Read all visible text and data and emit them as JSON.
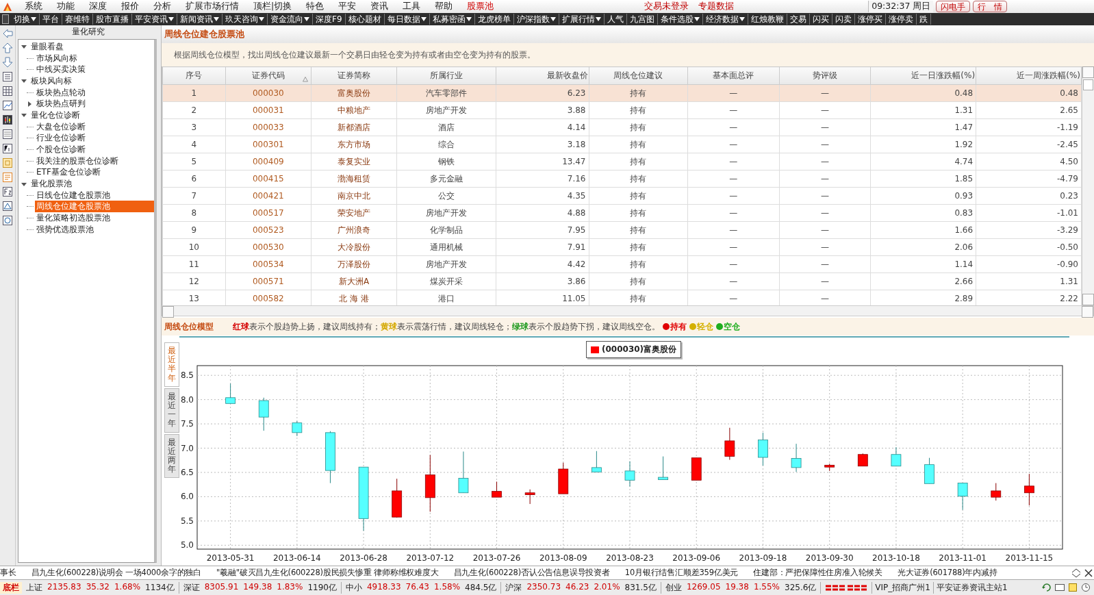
{
  "menu_bar": {
    "items": [
      {
        "label": "系统",
        "kind": "menu"
      },
      {
        "label": "功能",
        "kind": "menu"
      },
      {
        "label": "深度",
        "kind": "menu"
      },
      {
        "label": "报价",
        "kind": "menu"
      },
      {
        "label": "分析",
        "kind": "menu"
      },
      {
        "label": "扩展市场行情",
        "kind": "menu"
      },
      {
        "label": "顶栏|切换",
        "kind": "menu"
      },
      {
        "label": "特色",
        "kind": "menu"
      },
      {
        "label": "平安",
        "kind": "menu"
      },
      {
        "label": "资讯",
        "kind": "menu"
      },
      {
        "label": "工具",
        "kind": "menu"
      },
      {
        "label": "帮助",
        "kind": "menu"
      },
      {
        "label": "股票池",
        "kind": "highlight"
      }
    ],
    "notices": [
      "交易未登录",
      "专题数据"
    ],
    "clock": "09:32:37 周日",
    "buttons": [
      "闪电手",
      "行　情"
    ]
  },
  "toolbar": {
    "items": [
      {
        "label": "切换",
        "dropdown": true
      },
      {
        "label": "平台",
        "dropdown": false
      },
      {
        "label": "赛维特",
        "dropdown": false
      },
      {
        "label": "股市直播",
        "dropdown": false
      },
      {
        "label": "平安资讯",
        "dropdown": true
      },
      {
        "label": "新闻资讯",
        "dropdown": true
      },
      {
        "label": "玖天咨询",
        "dropdown": true
      },
      {
        "label": "资金流向",
        "dropdown": true
      },
      {
        "label": "深度F9",
        "dropdown": false
      },
      {
        "label": "核心题材",
        "dropdown": false
      },
      {
        "label": "每日数据",
        "dropdown": true
      },
      {
        "label": "私募密函",
        "dropdown": true
      },
      {
        "label": "龙虎榜单",
        "dropdown": false
      },
      {
        "label": "沪深指数",
        "dropdown": true
      },
      {
        "label": "扩展行情",
        "dropdown": true
      },
      {
        "label": "人气",
        "dropdown": false
      },
      {
        "label": "九宫图",
        "dropdown": false
      },
      {
        "label": "条件选股",
        "dropdown": true
      },
      {
        "label": "经济数据",
        "dropdown": true
      },
      {
        "label": "红烛教鞭",
        "dropdown": false
      },
      {
        "label": "交易",
        "dropdown": false
      },
      {
        "label": "闪买",
        "dropdown": false
      },
      {
        "label": "闪卖",
        "dropdown": false
      },
      {
        "label": "涨停买",
        "dropdown": false
      },
      {
        "label": "涨停卖",
        "dropdown": false
      },
      {
        "label": "跌",
        "dropdown": false
      }
    ]
  },
  "tree": {
    "title": "量化研究",
    "items": [
      {
        "label": "量眼看盘",
        "expanded": true,
        "selected": false,
        "children": [
          {
            "label": "市场风向标",
            "selected": false
          },
          {
            "label": "中线买卖决策",
            "selected": false
          }
        ]
      },
      {
        "label": "板块风向标",
        "expanded": true,
        "selected": false,
        "children": [
          {
            "label": "板块热点轮动",
            "selected": false
          },
          {
            "label": "板块热点研判",
            "expanded": false,
            "selected": false
          }
        ]
      },
      {
        "label": "量化仓位诊断",
        "expanded": true,
        "selected": false,
        "children": [
          {
            "label": "大盘仓位诊断",
            "selected": false
          },
          {
            "label": "行业仓位诊断",
            "selected": false
          },
          {
            "label": "个股仓位诊断",
            "selected": false
          },
          {
            "label": "我关注的股票仓位诊断",
            "selected": false
          },
          {
            "label": "ETF基金仓位诊断",
            "selected": false
          }
        ]
      },
      {
        "label": "量化股票池",
        "expanded": true,
        "selected": false,
        "children": [
          {
            "label": "日线仓位建仓股票池",
            "selected": false
          },
          {
            "label": "周线仓位建仓股票池",
            "selected": true
          },
          {
            "label": "量化策略初选股票池",
            "selected": false
          },
          {
            "label": "强势优选股票池",
            "selected": false
          }
        ]
      }
    ]
  },
  "pool": {
    "title": "周线仓位建仓股票池",
    "description": "根据周线仓位模型，找出周线仓位建议最新一个交易日由轻仓变为持有或者由空仓变为持有的股票。",
    "table": {
      "columns": [
        {
          "label": "序号",
          "sorted": false
        },
        {
          "label": "证券代码",
          "sorted": true
        },
        {
          "label": "证券简称",
          "sorted": false
        },
        {
          "label": "所属行业",
          "sorted": false
        },
        {
          "label": "最新收盘价",
          "sorted": false
        },
        {
          "label": "周线仓位建议",
          "sorted": false
        },
        {
          "label": "基本面总评",
          "sorted": false
        },
        {
          "label": "势评级",
          "sorted": false
        },
        {
          "label": "近一日涨跌幅(%)",
          "sorted": false
        },
        {
          "label": "近一周涨跌幅(%)",
          "sorted": false
        }
      ],
      "rows": [
        {
          "selected": true,
          "cells": [
            "1",
            "000030",
            "富奥股份",
            "汽车零部件",
            "6.23",
            "持有",
            "—",
            "—",
            "0.48",
            "0.48"
          ]
        },
        {
          "selected": false,
          "cells": [
            "2",
            "000031",
            "中粮地产",
            "房地产开发",
            "3.88",
            "持有",
            "—",
            "—",
            "1.31",
            "2.65"
          ]
        },
        {
          "selected": false,
          "cells": [
            "3",
            "000033",
            "新都酒店",
            "酒店",
            "4.14",
            "持有",
            "—",
            "—",
            "1.47",
            "-1.19"
          ]
        },
        {
          "selected": false,
          "cells": [
            "4",
            "000301",
            "东方市场",
            "综合",
            "3.18",
            "持有",
            "—",
            "—",
            "1.92",
            "-2.45"
          ]
        },
        {
          "selected": false,
          "cells": [
            "5",
            "000409",
            "泰复实业",
            "钢铁",
            "13.47",
            "持有",
            "—",
            "—",
            "4.74",
            "4.50"
          ]
        },
        {
          "selected": false,
          "cells": [
            "6",
            "000415",
            "渤海租赁",
            "多元金融",
            "7.16",
            "持有",
            "—",
            "—",
            "1.85",
            "-4.79"
          ]
        },
        {
          "selected": false,
          "cells": [
            "7",
            "000421",
            "南京中北",
            "公交",
            "4.35",
            "持有",
            "—",
            "—",
            "0.93",
            "0.23"
          ]
        },
        {
          "selected": false,
          "cells": [
            "8",
            "000517",
            "荣安地产",
            "房地产开发",
            "4.88",
            "持有",
            "—",
            "—",
            "0.83",
            "-1.01"
          ]
        },
        {
          "selected": false,
          "cells": [
            "9",
            "000523",
            "广州浪奇",
            "化学制品",
            "7.95",
            "持有",
            "—",
            "—",
            "1.66",
            "-3.29"
          ]
        },
        {
          "selected": false,
          "cells": [
            "10",
            "000530",
            "大冷股份",
            "通用机械",
            "7.91",
            "持有",
            "—",
            "—",
            "2.06",
            "-0.50"
          ]
        },
        {
          "selected": false,
          "cells": [
            "11",
            "000534",
            "万泽股份",
            "房地产开发",
            "4.42",
            "持有",
            "—",
            "—",
            "1.14",
            "-0.90"
          ]
        },
        {
          "selected": false,
          "cells": [
            "12",
            "000571",
            "新大洲A",
            "煤炭开采",
            "3.86",
            "持有",
            "—",
            "—",
            "2.66",
            "1.31"
          ]
        },
        {
          "selected": false,
          "cells": [
            "13",
            "000582",
            "北 海 港",
            "港口",
            "11.05",
            "持有",
            "—",
            "—",
            "2.89",
            "2.22"
          ]
        }
      ]
    }
  },
  "model_legend": {
    "title": "周线仓位模型",
    "notes": [
      {
        "ball": "红球",
        "color": "#d40000",
        "text": "表示个股趋势上扬，建议周线持有；"
      },
      {
        "ball": "黄球",
        "color": "#d4a800",
        "text": "表示震荡行情，建议周线轻仓；"
      },
      {
        "ball": "绿球",
        "color": "#1f9a1f",
        "text": "表示个股趋势下拐，建议周线空仓。"
      }
    ],
    "keys": [
      {
        "label": "持有",
        "color": "#e00000"
      },
      {
        "label": "轻仓",
        "color": "#d4b000"
      },
      {
        "label": "空仓",
        "color": "#1fae1f"
      }
    ]
  },
  "chart": {
    "tabs": [
      {
        "label": "最近半年",
        "selected": true
      },
      {
        "label": "最近一年",
        "selected": false
      },
      {
        "label": "最近两年",
        "selected": false
      }
    ],
    "chart_data": {
      "type": "candlestick",
      "categories": [
        "2013-05-31",
        null,
        "2013-06-14",
        null,
        "2013-06-28",
        null,
        "2013-07-12",
        null,
        "2013-07-26",
        null,
        "2013-08-09",
        null,
        "2013-08-23",
        null,
        "2013-09-06",
        null,
        "2013-09-18",
        null,
        "2013-09-30",
        null,
        "2013-10-18",
        null,
        "2013-11-01",
        null,
        "2013-11-15"
      ],
      "ylim": [
        4.92,
        8.7
      ],
      "grid": true,
      "yticks": [
        {
          "value": 5,
          "label": "5.0"
        },
        {
          "value": 5.5,
          "label": "5.5"
        },
        {
          "value": 6,
          "label": "6.0"
        },
        {
          "value": 6.5,
          "label": "6.5"
        },
        {
          "value": 7,
          "label": "7.0"
        },
        {
          "value": 7.5,
          "label": "7.5"
        },
        {
          "value": 8,
          "label": "8.0"
        },
        {
          "value": 8.5,
          "label": "8.5"
        }
      ],
      "series": [
        {
          "name": "(000030)富奥股份",
          "ohlc": [
            [
              8.04,
              8.33,
              7.92,
              7.92
            ],
            [
              7.98,
              8.04,
              7.36,
              7.64
            ],
            [
              7.52,
              7.56,
              7.25,
              7.32
            ],
            [
              7.32,
              7.35,
              6.28,
              6.54
            ],
            [
              6.61,
              6.61,
              5.3,
              5.55
            ],
            [
              5.58,
              6.37,
              5.57,
              6.12
            ],
            [
              5.98,
              6.86,
              5.69,
              6.45
            ],
            [
              6.38,
              6.93,
              6.08,
              6.08
            ],
            [
              5.99,
              6.31,
              5.99,
              6.11
            ],
            [
              6.04,
              6.15,
              5.85,
              6.08
            ],
            [
              6.06,
              6.7,
              6.06,
              6.57
            ],
            [
              6.6,
              6.94,
              6.51,
              6.51
            ],
            [
              6.53,
              6.73,
              6.21,
              6.34
            ],
            [
              6.4,
              6.83,
              6.35,
              6.35
            ],
            [
              6.34,
              6.8,
              6.34,
              6.8
            ],
            [
              6.83,
              7.42,
              6.76,
              7.15
            ],
            [
              7.17,
              7.32,
              6.64,
              6.81
            ],
            [
              6.79,
              7.09,
              6.51,
              6.6
            ],
            [
              6.61,
              6.68,
              6.53,
              6.65
            ],
            [
              6.63,
              6.89,
              6.63,
              6.87
            ],
            [
              6.87,
              7.02,
              6.63,
              6.63
            ],
            [
              6.66,
              6.8,
              6.27,
              6.27
            ],
            [
              6.28,
              6.28,
              5.73,
              6.01
            ],
            [
              5.99,
              6.28,
              5.92,
              6.12
            ],
            [
              6.08,
              6.47,
              5.82,
              6.22
            ]
          ]
        }
      ]
    }
  },
  "news_ticker": {
    "items": [
      "事长",
      "昌九生化(600228)说明会 一场4000余字的独白",
      "\"羲融\"破灭昌九生化(600228)股民损失惨重 律师称维权难度大",
      "昌九生化(600228)否认公告信息误导投资者",
      "10月银行结售汇顺差359亿美元",
      "住建部：严把保障性住房准入轮候关",
      "光大证券(601788)年内减持"
    ]
  },
  "status_bar": {
    "badge": "底栏",
    "indices": [
      {
        "name": "上证",
        "value": "2135.83",
        "change": "35.32",
        "percent": "1.68%",
        "amount": "1134亿"
      },
      {
        "name": "深证",
        "value": "8305.91",
        "change": "149.38",
        "percent": "1.83%",
        "amount": "1190亿"
      },
      {
        "name": "中小",
        "value": "4918.33",
        "change": "76.43",
        "percent": "1.58%",
        "amount": "484.5亿"
      },
      {
        "name": "沪深",
        "value": "2350.73",
        "change": "46.23",
        "percent": "2.01%",
        "amount": "831.5亿"
      },
      {
        "name": "创业",
        "value": "1269.05",
        "change": "19.38",
        "percent": "1.55%",
        "amount": "325.6亿"
      }
    ],
    "servers": [
      "VIP_招商广州1",
      "平安证券资讯主站1"
    ]
  }
}
